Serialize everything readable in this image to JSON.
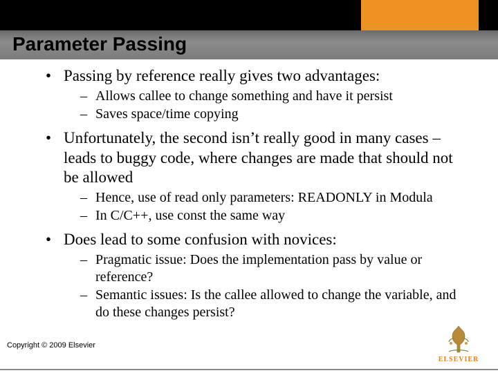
{
  "title": "Parameter Passing",
  "bullets": [
    {
      "text": "Passing by reference really gives two advantages:",
      "sub": [
        "Allows callee to change something and have it persist",
        "Saves space/time copying"
      ]
    },
    {
      "text": "Unfortunately, the second isn’t really good in many cases – leads to buggy code, where changes are made that should not be allowed",
      "sub": [
        "Hence, use of read only parameters: READONLY in Modula",
        "In C/C++, use const the same way"
      ]
    },
    {
      "text": "Does lead to some confusion with novices:",
      "sub": [
        "Pragmatic issue: Does the implementation pass by value or reference?",
        "Semantic issues: Is the callee allowed to change the variable, and do these changes persist?"
      ]
    }
  ],
  "copyright": "Copyright © 2009 Elsevier",
  "logo_text": "ELSEVIER"
}
